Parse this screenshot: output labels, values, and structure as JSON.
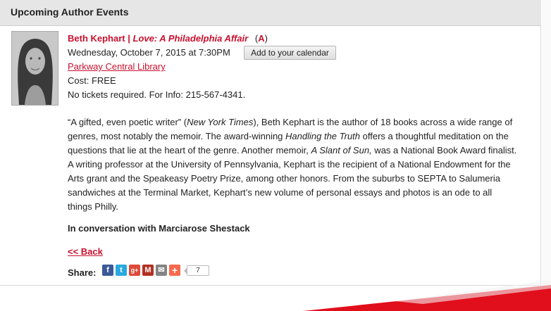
{
  "panel": {
    "title": "Upcoming Author Events"
  },
  "event": {
    "author": "Beth Kephart",
    "separator": " | ",
    "book_title": "Love: A Philadelphia Affair",
    "badge_open": "(",
    "badge": "A",
    "badge_close": ")",
    "datetime": "Wednesday, October 7, 2015 at 7:30PM",
    "calendar_button": "Add to your calendar",
    "venue": "Parkway Central Library",
    "cost": "Cost: FREE",
    "tickets": "No tickets required. For Info: 215-567-4341.",
    "description": {
      "quote": "“A gifted, even poetic writer” (",
      "source": "New York Times",
      "p1": "), Beth Kephart is the author of 18 books across a wide range of genres, most notably the memoir. The award-winning ",
      "book1": "Handling the Truth",
      "p2": " offers a thoughtful meditation on the questions that lie at the heart of the genre. Another memoir, ",
      "book2": "A Slant of Sun,",
      "p3": " was a National Book Award finalist. A writing professor at the University of Pennsylvania, Kephart is the recipient of a National Endowment for the Arts grant and the Speakeasy Poetry Prize, among other honors. From the suburbs to SEPTA to Salumeria sandwiches at the Terminal Market, Kephart’s new volume of personal essays and photos is an ode to all things Philly."
    },
    "conversation": "In conversation with Marciarose Shestack",
    "back_link": "<< Back"
  },
  "share": {
    "label": "Share:",
    "icons": [
      {
        "name": "facebook-icon",
        "glyph": "f",
        "color": "#3b5998"
      },
      {
        "name": "twitter-icon",
        "glyph": "t",
        "color": "#2aa9e0"
      },
      {
        "name": "google-plus-icon",
        "glyph": "g+",
        "color": "#dd4b39"
      },
      {
        "name": "gmail-icon",
        "glyph": "M",
        "color": "#b23121"
      },
      {
        "name": "email-icon",
        "glyph": "✉",
        "color": "#848484"
      },
      {
        "name": "more-share-icon",
        "glyph": "+",
        "color": "#f8694d"
      }
    ],
    "count": "7"
  },
  "colors": {
    "accent": "#c8102e",
    "header_bg": "#e6e6e6"
  }
}
